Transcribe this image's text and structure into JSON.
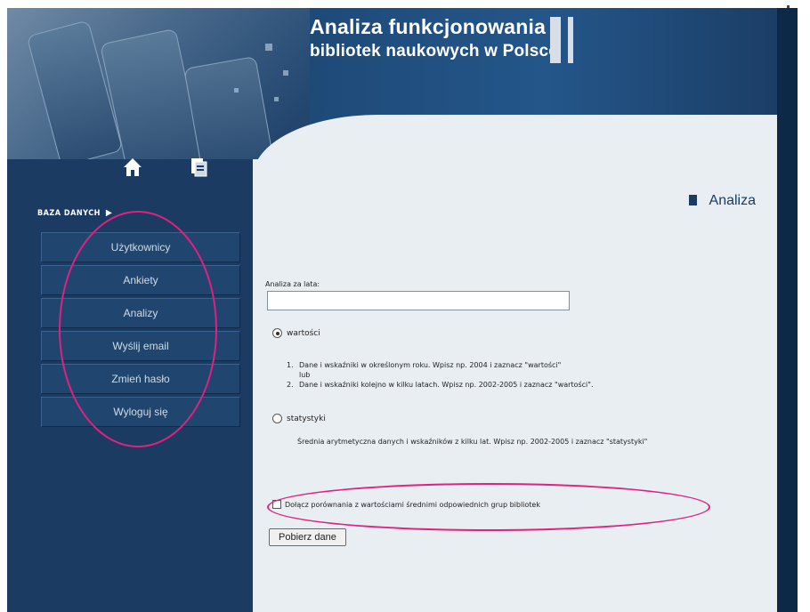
{
  "header": {
    "title_line1": "Analiza funkcjonowania",
    "title_line2": "bibliotek naukowych w Polsce"
  },
  "icons": {
    "home": "home-icon",
    "document": "document-icon"
  },
  "sidebar": {
    "section_label": "BAZA DANYCH",
    "section_arrow": "▶",
    "items": [
      {
        "label": "Użytkownicy"
      },
      {
        "label": "Ankiety"
      },
      {
        "label": "Analizy"
      },
      {
        "label": "Wyślij email"
      },
      {
        "label": "Zmień hasło"
      },
      {
        "label": "Wyloguj się"
      }
    ]
  },
  "main": {
    "page_title": "Analiza",
    "years_label": "Analiza za lata:",
    "years_value": "",
    "option_values": {
      "label": "wartości",
      "selected": true,
      "steps": [
        {
          "num": "1.",
          "text": "Dane i wskaźniki w określonym roku. Wpisz np. 2004 i zaznacz \"wartości\""
        },
        {
          "num": "2.",
          "text": "Dane i wskaźniki kolejno w kilku latach. Wpisz np. 2002-2005 i zaznacz \"wartości\"."
        }
      ],
      "or_text": "lub"
    },
    "option_stats": {
      "label": "statystyki",
      "selected": false,
      "description": "Średnia arytmetyczna danych i wskaźników z kilku lat. Wpisz np. 2002-2005 i zaznacz \"statystyki\""
    },
    "compare_checkbox": {
      "label": "Dołącz porównania z wartościami średnimi odpowiednich grup bibliotek",
      "checked": false
    },
    "submit_label": "Pobierz dane"
  },
  "colors": {
    "navy": "#1b3b62",
    "content_bg": "#e9eef2",
    "annotation": "#e0217f"
  }
}
